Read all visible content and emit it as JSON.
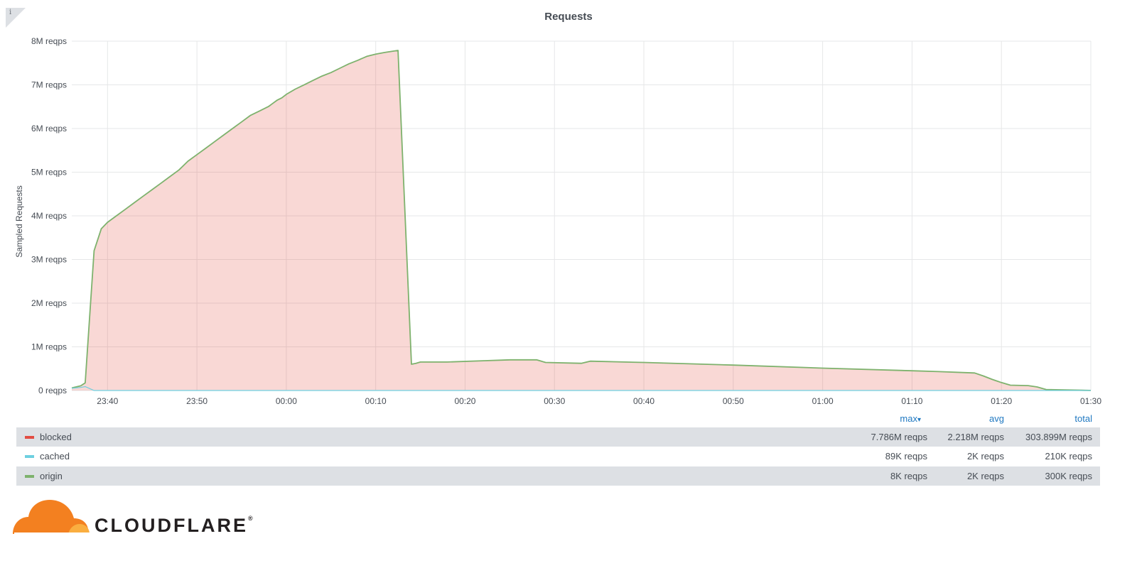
{
  "panel": {
    "title": "Requests",
    "info_glyph": "i"
  },
  "chart_data": {
    "type": "area",
    "title": "Requests",
    "ylabel": "Sampled Requests",
    "xlabel": "",
    "ylim": [
      0,
      8000000
    ],
    "y_ticks": [
      "0 reqps",
      "1M reqps",
      "2M reqps",
      "3M reqps",
      "4M reqps",
      "5M reqps",
      "6M reqps",
      "7M reqps",
      "8M reqps"
    ],
    "x_range": [
      "23:36",
      "01:30"
    ],
    "x_ticks": [
      "23:40",
      "23:50",
      "00:00",
      "00:10",
      "00:20",
      "00:30",
      "00:40",
      "00:50",
      "01:00",
      "01:10",
      "01:20",
      "01:30"
    ],
    "grid": true,
    "series": [
      {
        "name": "blocked",
        "color": "#e24d42",
        "x": [
          "23:36",
          "23:37",
          "23:37.5",
          "23:38.5",
          "23:39.3",
          "23:40",
          "23:41",
          "23:42",
          "23:43",
          "23:44",
          "23:45",
          "23:46",
          "23:47",
          "23:48",
          "23:49",
          "23:50",
          "23:51",
          "23:52",
          "23:53",
          "23:54",
          "23:55",
          "23:56",
          "23:57",
          "23:58",
          "23:59",
          "23:59.5",
          "00:00",
          "00:01",
          "00:02",
          "00:03",
          "00:04",
          "00:05",
          "00:06",
          "00:07",
          "00:08",
          "00:09",
          "00:10",
          "00:11",
          "00:12.5",
          "00:14",
          "00:14.5",
          "00:15",
          "00:18",
          "00:22",
          "00:25",
          "00:28",
          "00:29",
          "00:33",
          "00:34",
          "00:40",
          "00:50",
          "01:00",
          "01:10",
          "01:13",
          "01:17",
          "01:18",
          "01:19",
          "01:20",
          "01:21",
          "01:23",
          "01:24",
          "01:25",
          "01:30"
        ],
        "values": [
          0,
          30000,
          80000,
          3200000,
          3700000,
          3850000,
          4000000,
          4150000,
          4300000,
          4450000,
          4600000,
          4750000,
          4900000,
          5050000,
          5250000,
          5400000,
          5550000,
          5700000,
          5850000,
          6000000,
          6150000,
          6300000,
          6400000,
          6500000,
          6650000,
          6700000,
          6780000,
          6900000,
          7000000,
          7100000,
          7200000,
          7280000,
          7380000,
          7480000,
          7560000,
          7650000,
          7700000,
          7740000,
          7786000,
          600000,
          620000,
          650000,
          650000,
          680000,
          700000,
          700000,
          640000,
          620000,
          670000,
          640000,
          580000,
          510000,
          450000,
          430000,
          400000,
          330000,
          250000,
          180000,
          120000,
          110000,
          80000,
          20000,
          0
        ]
      },
      {
        "name": "cached",
        "color": "#6ed0e0",
        "x": [
          "23:36",
          "23:37",
          "23:37.5",
          "23:38.5",
          "01:30"
        ],
        "values": [
          50000,
          70000,
          89000,
          0,
          0
        ]
      },
      {
        "name": "origin",
        "color": "#7eb26d",
        "x": [
          "23:36",
          "23:37.5",
          "23:38.5",
          "01:30"
        ],
        "values": [
          8000,
          6000,
          2000,
          2000
        ]
      }
    ],
    "legend": {
      "placement": "bottom",
      "headers": {
        "max": "max",
        "sort_glyph": "▾",
        "avg": "avg",
        "total": "total"
      },
      "rows": [
        {
          "name": "blocked",
          "color": "#e24d42",
          "max": "7.786M reqps",
          "avg": "2.218M reqps",
          "total": "303.899M reqps"
        },
        {
          "name": "cached",
          "color": "#6ed0e0",
          "max": "89K reqps",
          "avg": "2K reqps",
          "total": "210K reqps"
        },
        {
          "name": "origin",
          "color": "#7eb26d",
          "max": "8K reqps",
          "avg": "2K reqps",
          "total": "300K reqps"
        }
      ]
    }
  },
  "logo": {
    "wordmark": "CLOUDFLARE",
    "registered_mark": "®",
    "cloud_icon": "cloud-icon"
  }
}
